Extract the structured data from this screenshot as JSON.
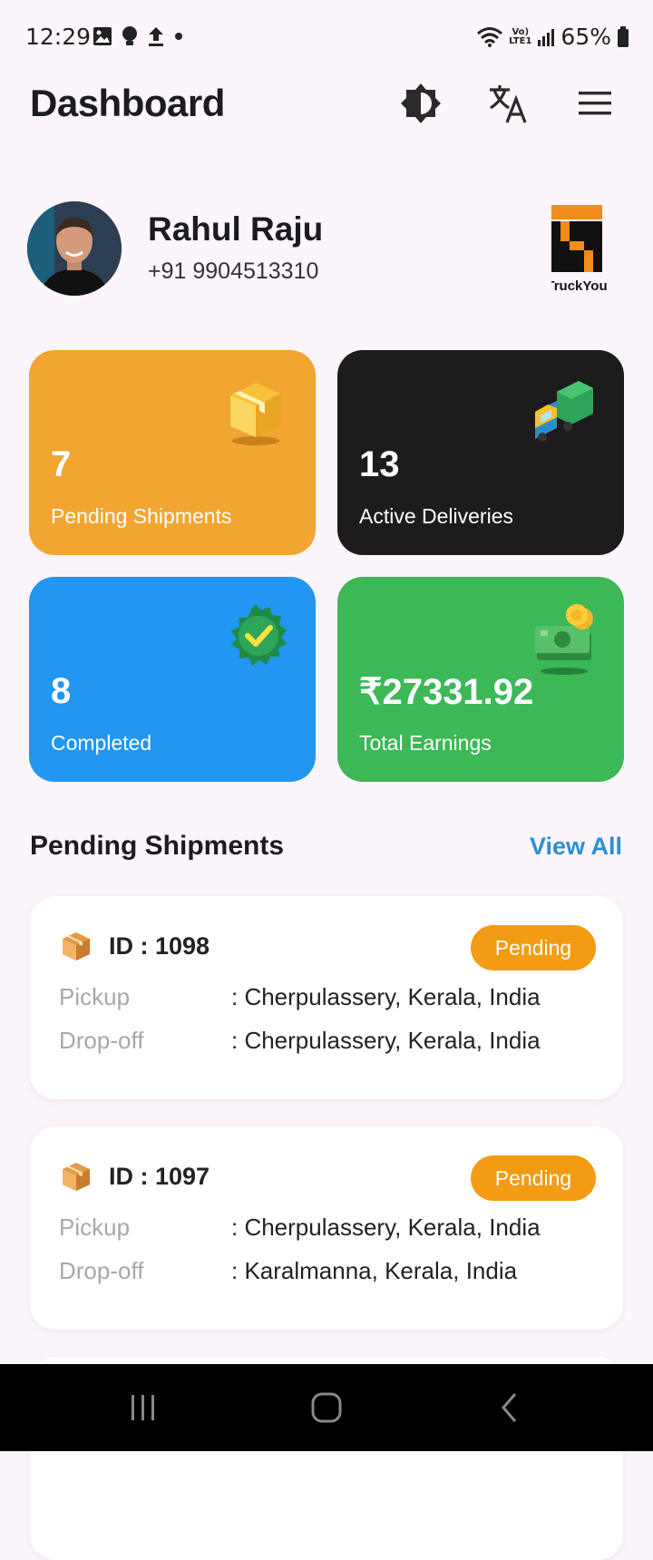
{
  "status_bar": {
    "time": "12:29",
    "network_type_top": "Vo)",
    "network_type_bottom": "LTE1",
    "battery": "65%"
  },
  "header": {
    "title": "Dashboard",
    "icons": [
      "brightness-icon",
      "translate-icon",
      "menu-icon"
    ]
  },
  "profile": {
    "name": "Rahul Raju",
    "phone": "+91 9904513310",
    "logo_text": "TruckYou"
  },
  "stats": [
    {
      "value": "7",
      "label": "Pending Shipments",
      "color": "#f2a531",
      "icon": "package-icon"
    },
    {
      "value": "13",
      "label": "Active Deliveries",
      "color": "#1e1b1c",
      "icon": "truck-icon"
    },
    {
      "value": "8",
      "label": "Completed",
      "color": "#2196f2",
      "icon": "verified-badge-icon"
    },
    {
      "value": "₹27331.92",
      "label": "Total Earnings",
      "color": "#3cb857",
      "icon": "money-icon"
    }
  ],
  "pending_section": {
    "title": "Pending Shipments",
    "view_all": "View All"
  },
  "shipments": [
    {
      "id": "ID : 1098",
      "status": "Pending",
      "pickup_label": "Pickup",
      "pickup": ": Cherpulassery, Kerala, India",
      "dropoff_label": "Drop-off",
      "dropoff": ": Cherpulassery, Kerala, India"
    },
    {
      "id": "ID : 1097",
      "status": "Pending",
      "pickup_label": "Pickup",
      "pickup": ": Cherpulassery, Kerala, India",
      "dropoff_label": "Drop-off",
      "dropoff": ": Karalmanna, Kerala, India"
    }
  ],
  "colors": {
    "badge": "#f39b12",
    "link": "#2d8fd5",
    "background": "#fcf6fc"
  }
}
